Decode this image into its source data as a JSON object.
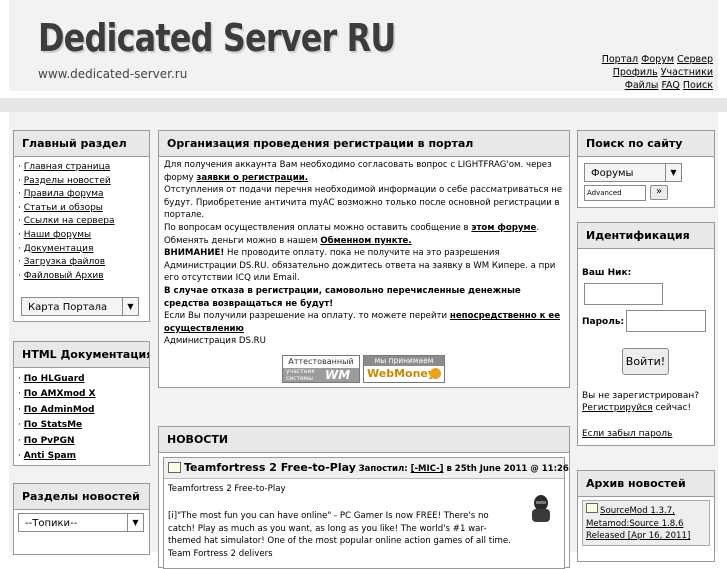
{
  "header": {
    "logo_text": "Dedicated Server RU",
    "site_url": "www.dedicated-server.ru",
    "nav_line1": [
      "Портал",
      "Форум",
      "Сервер"
    ],
    "nav_line2": [
      "Профиль",
      "Участники"
    ],
    "nav_line3": [
      "Файлы",
      "FAQ",
      "Поиск"
    ]
  },
  "left": {
    "main_section": {
      "title": "Главный раздел",
      "items": [
        "Главная страница",
        "Разделы новостей",
        "Правила форума",
        "Статьи и обзоры",
        "Ссылки на сервера",
        "Наши форумы",
        "Документация",
        "Загрузка файлов",
        "Файловый Архив"
      ],
      "select_value": "Карта Портала"
    },
    "html_docs": {
      "title": "HTML Документация",
      "items": [
        "По HLGuard",
        "По AMXmod X",
        "По AdminMod",
        "По StatsMe",
        "По PvPGN",
        "Anti Spam"
      ]
    },
    "news_sections": {
      "title": "Разделы новостей",
      "select_value": "--Топики--"
    }
  },
  "center": {
    "reg": {
      "title": "Организация проведения регистрации в портал",
      "p1": "Для получения аккаунта Вам необходимо согласовать вопрос с LIGHTFRAG'ом. через форму ",
      "p1_link": "заявки о регистрации.",
      "p2": "Отступления от подачи перечня необходимой информации о себе рассматриваться не будут. Приобретение античита myAC возможно только после основной регистрации в портале.",
      "p3": "По вопросам осуществления оплаты можно оставить сообщение в ",
      "p3_link": "этом форуме",
      "p3_end": ".",
      "p4": "Обменять деньги можно в нашем ",
      "p4_link": "Обменном пункте.",
      "p5_bold": "ВНИМАНИЕ!",
      "p5": " Не проводите оплату. пока не получите на это разрешения Администрации DS.RU. обязательно дождитесь ответа на заявку в WM Кипере. а при его отсутствии ICQ или Email.",
      "p6": "В случае отказа в регистрации, самовольно перечисленные денежные средства возвращаться не будут!",
      "p7": "Если Вы получили разрешение на оплату. то можете перейти ",
      "p7_link": "непосредственно к ее осуществлению",
      "p8": "Администрация DS.RU",
      "badge1_top": "Аттестованный",
      "badge1_bottom_a": "участник",
      "badge1_bottom_b": "системы",
      "badge1_wm": "WM",
      "badge2_top": "мы принимаем",
      "badge2_bottom": "WebMoney"
    },
    "news": {
      "title": "НОВОСТИ",
      "item_title": "Teamfortress 2 Free-to-Play",
      "posted": "Запостил: ",
      "author": "[-MIC-]",
      "date": " в 25th June 2011 @ 11:26",
      "subtitle": "Teamfortress 2 Free-to-Play",
      "body": "[i]\"The most fun you can have online\" - PC Gamer Is now FREE! There's no catch! Play as much as you want, as long as you like! The world's #1 war-themed hat simulator! One of the most popular online action games of all time. Team Fortress 2 delivers"
    }
  },
  "right": {
    "search": {
      "title": "Поиск по сайту",
      "select_value": "Форумы",
      "advanced_value": "Advanced",
      "go_label": "»"
    },
    "ident": {
      "title": "Идентификация",
      "nick_label": "Ваш Ник:",
      "pass_label": "Пароль:",
      "login_btn": "Войти!",
      "not_registered": "Вы не зaрегистрирован?",
      "register_link": "Регистрируйся",
      "register_tail": " сейчас!",
      "forgot_link": "Если забыл пароль"
    },
    "archive": {
      "title": "Архив новостей",
      "item": "SourceMod 1.3.7, Metamod:Source 1.8.6 Released [Apr 16, 2011]"
    }
  }
}
